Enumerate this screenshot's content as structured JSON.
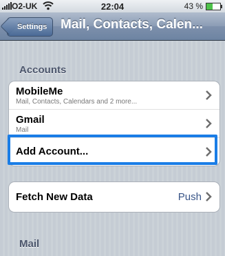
{
  "status_bar": {
    "carrier": "O2-UK",
    "time": "22:04",
    "battery_percent": "43 %",
    "battery_level": 0.43,
    "signal_icon": "signal-bars-icon",
    "wifi_icon": "wifi-icon"
  },
  "nav": {
    "back_label": "Settings",
    "title": "Mail, Contacts, Calen..."
  },
  "sections": {
    "accounts_header": "Accounts",
    "mail_header": "Mail"
  },
  "accounts": [
    {
      "title": "MobileMe",
      "subtitle": "Mail, Contacts, Calendars and 2 more..."
    },
    {
      "title": "Gmail",
      "subtitle": "Mail"
    },
    {
      "title": "Add Account..."
    }
  ],
  "fetch": {
    "title": "Fetch New Data",
    "value": "Push"
  },
  "colors": {
    "highlight": "#1a7de6",
    "value_text": "#385487"
  }
}
